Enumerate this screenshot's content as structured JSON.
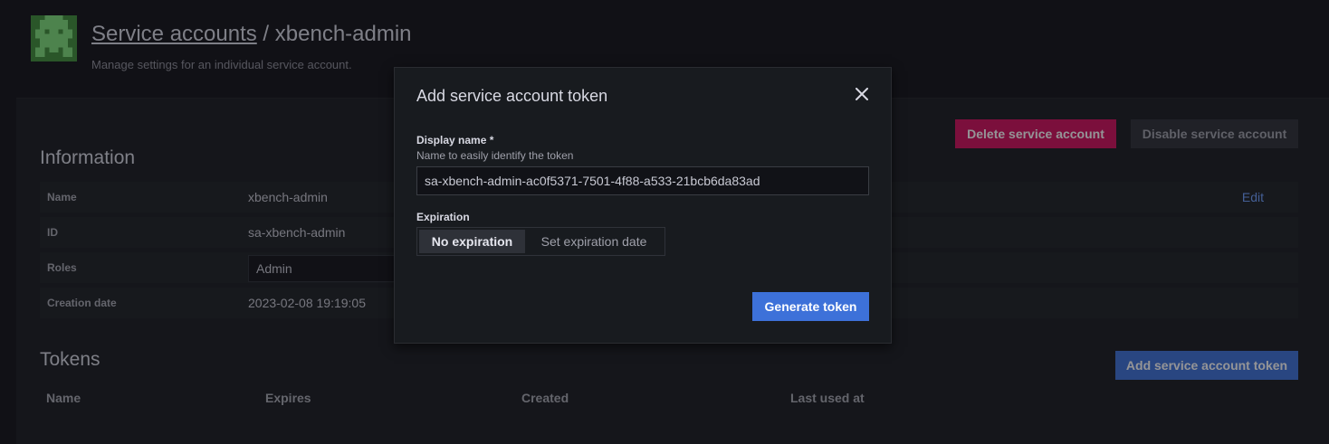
{
  "header": {
    "breadcrumb_link": "Service accounts",
    "breadcrumb_sep": " / ",
    "account_name": "xbench-admin",
    "subtitle": "Manage settings for an individual service account."
  },
  "actions": {
    "delete_label": "Delete service account",
    "disable_label": "Disable service account"
  },
  "information": {
    "title": "Information",
    "rows": [
      {
        "label": "Name",
        "value": "xbench-admin"
      },
      {
        "label": "ID",
        "value": "sa-xbench-admin"
      },
      {
        "label": "Roles",
        "value": "Admin"
      },
      {
        "label": "Creation date",
        "value": "2023-02-08 19:19:05"
      }
    ],
    "edit_label": "Edit"
  },
  "tokens": {
    "title": "Tokens",
    "add_label": "Add service account token",
    "columns": [
      "Name",
      "Expires",
      "Created",
      "Last used at"
    ]
  },
  "modal": {
    "title": "Add service account token",
    "display_name_label": "Display name *",
    "display_name_desc": "Name to easily identify the token",
    "display_name_value": "sa-xbench-admin-ac0f5371-7501-4f88-a533-21bcb6da83ad",
    "expiration_label": "Expiration",
    "expiration_options": [
      "No expiration",
      "Set expiration date"
    ],
    "expiration_selected": "No expiration",
    "generate_label": "Generate token"
  },
  "colors": {
    "delete": "#d10e5c",
    "primary": "#3d71d9",
    "background": "#111217",
    "panel": "#181b1f"
  },
  "icons": {
    "logo": "avatar-icon",
    "close": "close-icon"
  }
}
